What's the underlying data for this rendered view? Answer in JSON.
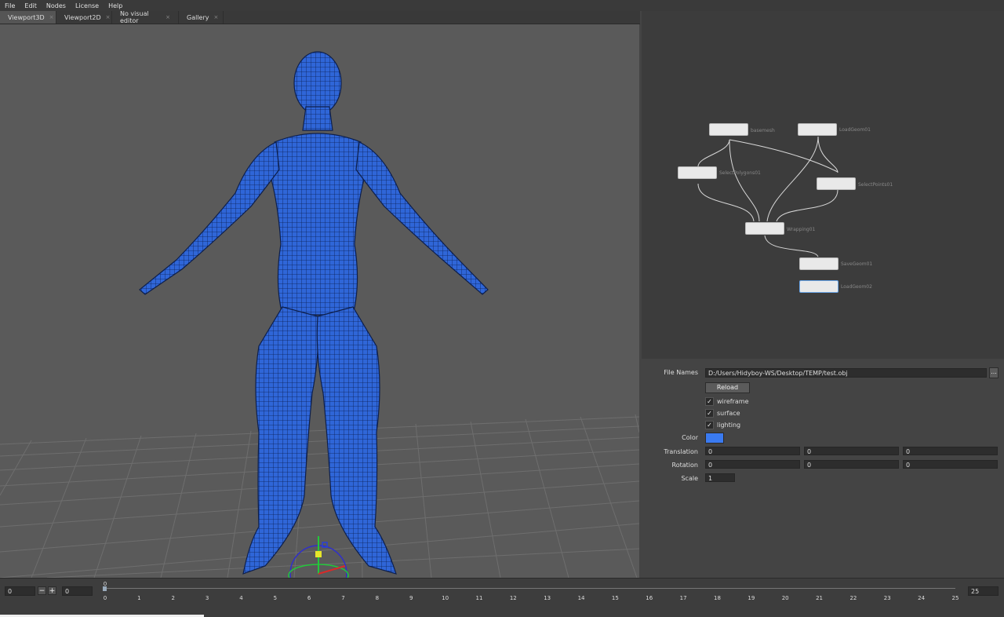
{
  "menu": [
    "File",
    "Edit",
    "Nodes",
    "License",
    "Help"
  ],
  "tabs": [
    {
      "label": "Viewport3D",
      "close": "×"
    },
    {
      "label": "Viewport2D",
      "close": "×"
    },
    {
      "label": "No visual editor",
      "close": "×"
    },
    {
      "label": "Gallery",
      "close": "×"
    }
  ],
  "graph": {
    "nodes": [
      "basemesh",
      "LoadGeom01",
      "SelectPolygons01",
      "SelectPoints01",
      "Wrapping01",
      "SaveGeom01",
      "LoadGeom02"
    ]
  },
  "props": {
    "file_names_label": "File Names",
    "file_path": "D:/Users/Hidyboy-WS/Desktop/TEMP/test.obj",
    "browse": "...",
    "reload": "Reload",
    "wireframe": "wireframe",
    "surface": "surface",
    "lighting": "lighting",
    "check_mark": "✓",
    "color_label": "Color",
    "color_value": "#3a7af0",
    "translation_label": "Translation",
    "translation": [
      "0",
      "0",
      "0"
    ],
    "rotation_label": "Rotation",
    "rotation": [
      "0",
      "0",
      "0"
    ],
    "scale_label": "Scale",
    "scale": "1"
  },
  "timeline": {
    "current": "0",
    "minus": "−",
    "plus": "+",
    "start": "0",
    "cursor_label": "0",
    "end": "25",
    "ticks": [
      "0",
      "1",
      "2",
      "3",
      "4",
      "5",
      "6",
      "7",
      "8",
      "9",
      "10",
      "11",
      "12",
      "13",
      "14",
      "15",
      "16",
      "17",
      "18",
      "19",
      "20",
      "21",
      "22",
      "23",
      "24",
      "25"
    ]
  }
}
